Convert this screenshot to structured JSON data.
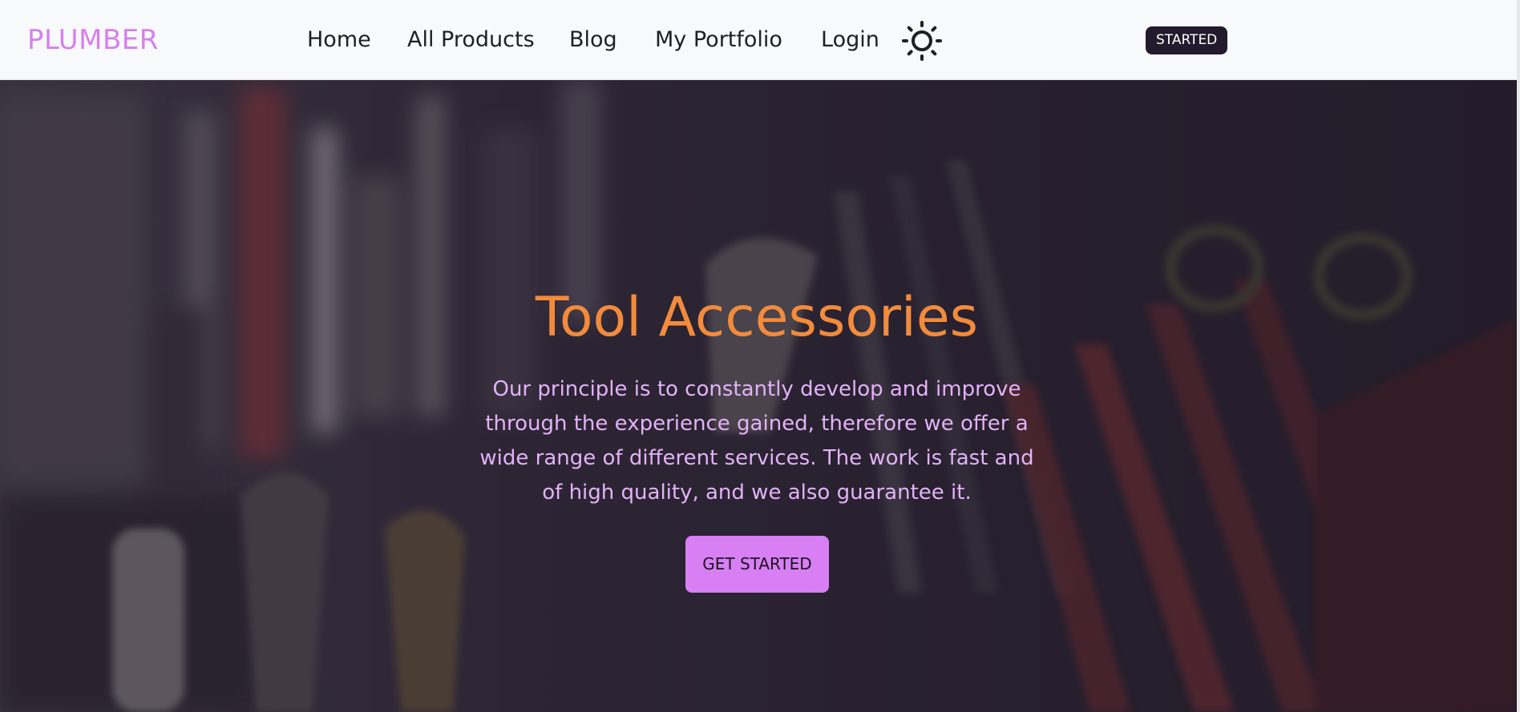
{
  "brand": {
    "name": "PLUMBER"
  },
  "nav": {
    "items": [
      {
        "label": "Home"
      },
      {
        "label": "All Products"
      },
      {
        "label": "Blog"
      },
      {
        "label": "My Portfolio"
      },
      {
        "label": "Login"
      }
    ],
    "theme_toggle_icon": "sun-icon",
    "badge_label": "STARTED"
  },
  "hero": {
    "title": "Tool Accessories",
    "description": "Our principle is to constantly develop and improve through the experience gained, therefore we offer a wide range of different services. The work is fast and of high quality, and we also guarantee it.",
    "cta_label": "GET STARTED",
    "background_image": "blurred-tools-photo"
  },
  "colors": {
    "brand": "#d77ff0",
    "title": "#f28b3c",
    "description": "#e2b2f7",
    "cta_background": "#d87ff4",
    "badge_background": "#231a2e",
    "navbar_background": "#f8f9fa"
  }
}
